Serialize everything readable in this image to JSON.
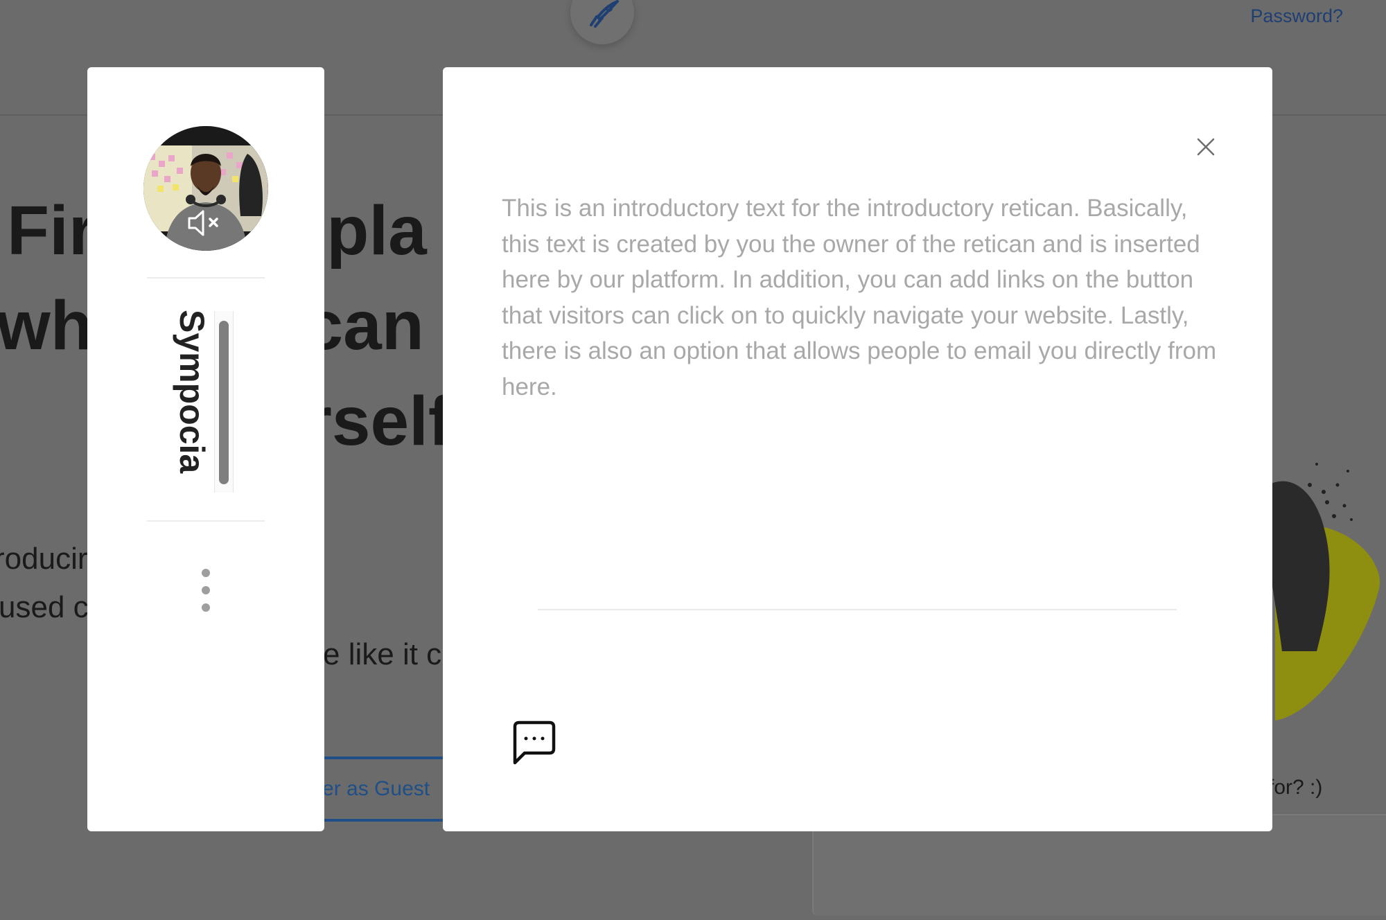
{
  "background": {
    "header": {
      "password_link": "Password?"
    },
    "hero": {
      "line1": "Fir         a pla",
      "line2": "whe         can",
      "line3": "rself",
      "para1": "roducir          al enterta",
      "para2": "used c          ng yours",
      "para3": "e like it c",
      "guest_button": "nter as Guest",
      "footer_question": "for? :)"
    }
  },
  "sidebar": {
    "title": "Sympocia",
    "avatar_status_icon": "speaker-muted-icon",
    "menu_icon": "vertical-dots-icon"
  },
  "modal": {
    "intro_text": "This is an introductory text for the introductory retican. Basically, this text is created by you the owner of the retican and is inserted here by our platform. In addition, you can add links on the button that visitors can click on to quickly navigate your website. Lastly, there is also an option that allows people to email you directly from here.",
    "close_icon": "close-icon",
    "chat_icon": "chat-bubble-icon"
  },
  "colors": {
    "overlay": "#6b6b6b",
    "panel": "#ffffff",
    "intro_text": "#a8a8a8",
    "link": "#1f3f73",
    "accent_yellow": "#a8a800"
  }
}
